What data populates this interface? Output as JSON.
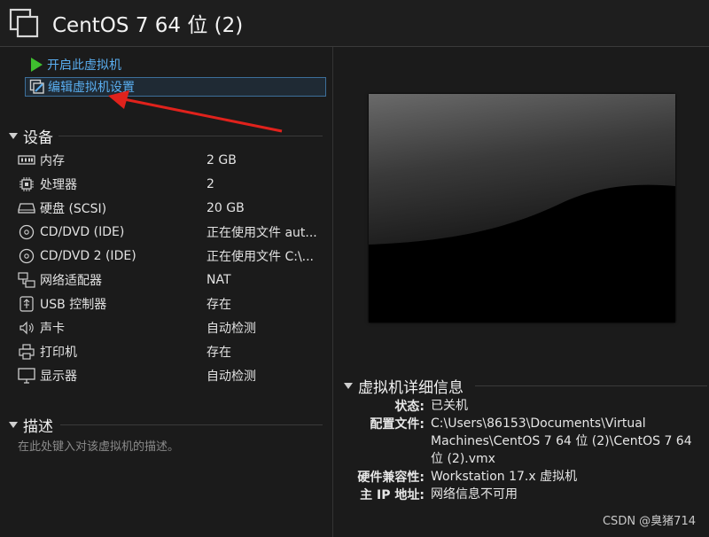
{
  "title": "CentOS 7 64 位 (2)",
  "actions": {
    "start": "开启此虚拟机",
    "edit": "编辑虚拟机设置"
  },
  "devices_section": {
    "heading": "设备",
    "items": [
      {
        "name": "内存",
        "value": "2 GB",
        "icon": "memory-icon"
      },
      {
        "name": "处理器",
        "value": "2",
        "icon": "processor-icon"
      },
      {
        "name": "硬盘 (SCSI)",
        "value": "20 GB",
        "icon": "hard-disk-icon"
      },
      {
        "name": "CD/DVD (IDE)",
        "value": "正在使用文件 aut...",
        "icon": "cd-dvd-icon"
      },
      {
        "name": "CD/DVD 2 (IDE)",
        "value": "正在使用文件 C:\\...",
        "icon": "cd-dvd-icon"
      },
      {
        "name": "网络适配器",
        "value": "NAT",
        "icon": "network-adapter-icon"
      },
      {
        "name": "USB 控制器",
        "value": "存在",
        "icon": "usb-icon"
      },
      {
        "name": "声卡",
        "value": "自动检测",
        "icon": "sound-card-icon"
      },
      {
        "name": "打印机",
        "value": "存在",
        "icon": "printer-icon"
      },
      {
        "name": "显示器",
        "value": "自动检测",
        "icon": "display-icon"
      }
    ]
  },
  "description_section": {
    "heading": "描述",
    "placeholder": "在此处键入对该虚拟机的描述。"
  },
  "details_section": {
    "heading": "虚拟机详细信息",
    "status_label": "状态:",
    "status_value": "已关机",
    "config_label": "配置文件:",
    "config_value": "C:\\Users\\86153\\Documents\\Virtual Machines\\CentOS 7 64 位 (2)\\CentOS 7 64 位 (2).vmx",
    "compat_label": "硬件兼容性:",
    "compat_value": "Workstation 17.x 虚拟机",
    "ip_label": "主 IP 地址:",
    "ip_value": "网络信息不可用"
  },
  "watermark": "CSDN @臭猪714",
  "colors": {
    "background": "#1b1b1b",
    "link": "#5aaef0",
    "accent_arrow": "#e0221c",
    "play_green": "#3fbf2f"
  }
}
